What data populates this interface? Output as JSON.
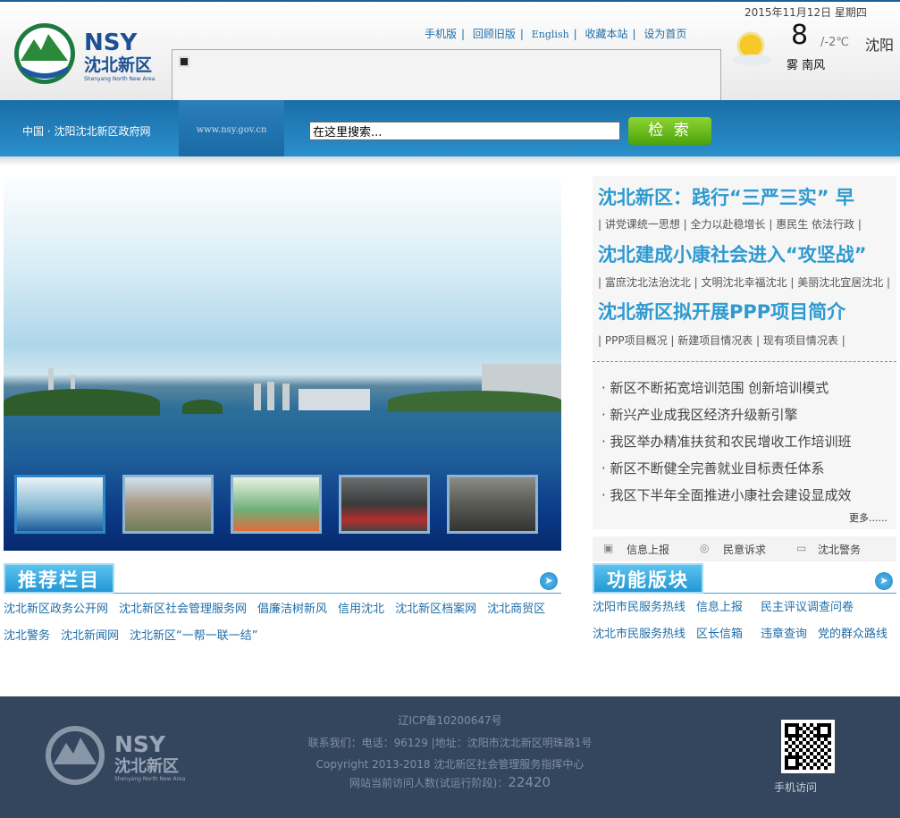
{
  "header": {
    "logo": {
      "abbr": "NSY",
      "name": "沈北新区",
      "en": "Shenyang North New Area"
    },
    "links": [
      "手机版",
      "回顾旧版",
      "English",
      "收藏本站",
      "设为首页"
    ],
    "date": "2015年11月12日  星期四",
    "weather": {
      "icon": "sun-cloud-icon",
      "temp": "8",
      "low": "/-2℃",
      "city": "沈阳",
      "condition": "雾  南风"
    }
  },
  "navbar": {
    "breadcrumb": "中国  ·  沈阳沈北新区政府网",
    "url": "www.nsy.gov.cn",
    "search_value": "在这里搜索...",
    "search_button": "检 索"
  },
  "right_panel": {
    "headlines": [
      {
        "title": "沈北新区：践行“三严三实”  早",
        "sub": "| 讲党课统一思想 | 全力以赴稳增长 | 惠民生 依法行政 |"
      },
      {
        "title": "沈北建成小康社会进入“攻坚战”",
        "sub": "| 富庶沈北法治沈北 | 文明沈北幸福沈北 | 美丽沈北宜居沈北 |"
      },
      {
        "title": "沈北新区拟开展PPP项目简介",
        "sub": "| PPP项目概况 | 新建项目情况表 | 现有项目情况表 |"
      }
    ],
    "news": [
      "· 新区不断拓宽培训范围 创新培训模式",
      "· 新兴产业成我区经济升级新引擎",
      "· 我区举办精准扶贫和农民增收工作培训班",
      "· 新区不断健全完善就业目标责任体系",
      "· 我区下半年全面推进小康社会建设显成效"
    ],
    "more": "更多......",
    "tabs": [
      {
        "label": "信息上报",
        "icon": "chat-icon"
      },
      {
        "label": "民意诉求",
        "icon": "weibo-icon"
      },
      {
        "label": "沈北警务",
        "icon": "video-icon"
      }
    ]
  },
  "recommend": {
    "title": "推荐栏目",
    "links": [
      "沈北新区政务公开网",
      "沈北新区社会管理服务网",
      "倡廉洁树新风",
      "信用沈北",
      "沈北新区档案网",
      "沈北商贸区",
      "沈北警务",
      "沈北新闻网",
      "沈北新区“一帮一联一结”"
    ]
  },
  "functions": {
    "title": "功能版块",
    "links": [
      "沈阳市民服务热线",
      "信息上报",
      "民主评议调查问卷",
      "沈北市民服务热线",
      "区长信箱",
      "违章查询",
      "党的群众路线"
    ]
  },
  "footer": {
    "icp": "辽ICP备10200647号",
    "contact": "联系我们：电话：96129 |地址：沈阳市沈北新区明珠路1号",
    "copyright": "Copyright 2013-2018 沈北新区社会管理服务指挥中心",
    "visitors_label": "网站当前访问人数(试运行阶段)：",
    "visitors": "22420",
    "qr_label": "手机访问"
  }
}
